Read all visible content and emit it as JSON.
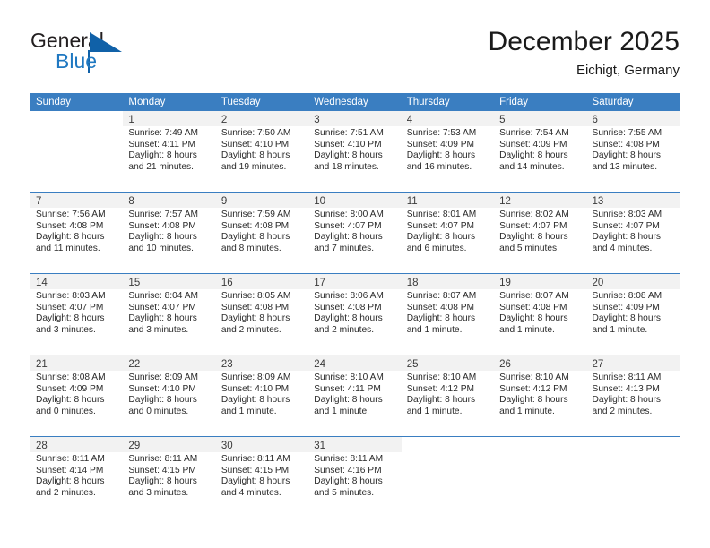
{
  "brand": {
    "name_primary": "General",
    "name_secondary": "Blue",
    "triangle_color": "#1061a8",
    "secondary_color": "#1f78c1"
  },
  "header": {
    "month_title": "December 2025",
    "location": "Eichigt, Germany"
  },
  "theme": {
    "header_blue": "#3a7ec1",
    "daynum_band": "#f2f2f2",
    "text": "#2a2a2a"
  },
  "calendar": {
    "weekday_headers": [
      "Sunday",
      "Monday",
      "Tuesday",
      "Wednesday",
      "Thursday",
      "Friday",
      "Saturday"
    ],
    "weeks": [
      [
        {
          "day": "",
          "lines": []
        },
        {
          "day": "1",
          "lines": [
            "Sunrise: 7:49 AM",
            "Sunset: 4:11 PM",
            "Daylight: 8 hours",
            "and 21 minutes."
          ]
        },
        {
          "day": "2",
          "lines": [
            "Sunrise: 7:50 AM",
            "Sunset: 4:10 PM",
            "Daylight: 8 hours",
            "and 19 minutes."
          ]
        },
        {
          "day": "3",
          "lines": [
            "Sunrise: 7:51 AM",
            "Sunset: 4:10 PM",
            "Daylight: 8 hours",
            "and 18 minutes."
          ]
        },
        {
          "day": "4",
          "lines": [
            "Sunrise: 7:53 AM",
            "Sunset: 4:09 PM",
            "Daylight: 8 hours",
            "and 16 minutes."
          ]
        },
        {
          "day": "5",
          "lines": [
            "Sunrise: 7:54 AM",
            "Sunset: 4:09 PM",
            "Daylight: 8 hours",
            "and 14 minutes."
          ]
        },
        {
          "day": "6",
          "lines": [
            "Sunrise: 7:55 AM",
            "Sunset: 4:08 PM",
            "Daylight: 8 hours",
            "and 13 minutes."
          ]
        }
      ],
      [
        {
          "day": "7",
          "lines": [
            "Sunrise: 7:56 AM",
            "Sunset: 4:08 PM",
            "Daylight: 8 hours",
            "and 11 minutes."
          ]
        },
        {
          "day": "8",
          "lines": [
            "Sunrise: 7:57 AM",
            "Sunset: 4:08 PM",
            "Daylight: 8 hours",
            "and 10 minutes."
          ]
        },
        {
          "day": "9",
          "lines": [
            "Sunrise: 7:59 AM",
            "Sunset: 4:08 PM",
            "Daylight: 8 hours",
            "and 8 minutes."
          ]
        },
        {
          "day": "10",
          "lines": [
            "Sunrise: 8:00 AM",
            "Sunset: 4:07 PM",
            "Daylight: 8 hours",
            "and 7 minutes."
          ]
        },
        {
          "day": "11",
          "lines": [
            "Sunrise: 8:01 AM",
            "Sunset: 4:07 PM",
            "Daylight: 8 hours",
            "and 6 minutes."
          ]
        },
        {
          "day": "12",
          "lines": [
            "Sunrise: 8:02 AM",
            "Sunset: 4:07 PM",
            "Daylight: 8 hours",
            "and 5 minutes."
          ]
        },
        {
          "day": "13",
          "lines": [
            "Sunrise: 8:03 AM",
            "Sunset: 4:07 PM",
            "Daylight: 8 hours",
            "and 4 minutes."
          ]
        }
      ],
      [
        {
          "day": "14",
          "lines": [
            "Sunrise: 8:03 AM",
            "Sunset: 4:07 PM",
            "Daylight: 8 hours",
            "and 3 minutes."
          ]
        },
        {
          "day": "15",
          "lines": [
            "Sunrise: 8:04 AM",
            "Sunset: 4:07 PM",
            "Daylight: 8 hours",
            "and 3 minutes."
          ]
        },
        {
          "day": "16",
          "lines": [
            "Sunrise: 8:05 AM",
            "Sunset: 4:08 PM",
            "Daylight: 8 hours",
            "and 2 minutes."
          ]
        },
        {
          "day": "17",
          "lines": [
            "Sunrise: 8:06 AM",
            "Sunset: 4:08 PM",
            "Daylight: 8 hours",
            "and 2 minutes."
          ]
        },
        {
          "day": "18",
          "lines": [
            "Sunrise: 8:07 AM",
            "Sunset: 4:08 PM",
            "Daylight: 8 hours",
            "and 1 minute."
          ]
        },
        {
          "day": "19",
          "lines": [
            "Sunrise: 8:07 AM",
            "Sunset: 4:08 PM",
            "Daylight: 8 hours",
            "and 1 minute."
          ]
        },
        {
          "day": "20",
          "lines": [
            "Sunrise: 8:08 AM",
            "Sunset: 4:09 PM",
            "Daylight: 8 hours",
            "and 1 minute."
          ]
        }
      ],
      [
        {
          "day": "21",
          "lines": [
            "Sunrise: 8:08 AM",
            "Sunset: 4:09 PM",
            "Daylight: 8 hours",
            "and 0 minutes."
          ]
        },
        {
          "day": "22",
          "lines": [
            "Sunrise: 8:09 AM",
            "Sunset: 4:10 PM",
            "Daylight: 8 hours",
            "and 0 minutes."
          ]
        },
        {
          "day": "23",
          "lines": [
            "Sunrise: 8:09 AM",
            "Sunset: 4:10 PM",
            "Daylight: 8 hours",
            "and 1 minute."
          ]
        },
        {
          "day": "24",
          "lines": [
            "Sunrise: 8:10 AM",
            "Sunset: 4:11 PM",
            "Daylight: 8 hours",
            "and 1 minute."
          ]
        },
        {
          "day": "25",
          "lines": [
            "Sunrise: 8:10 AM",
            "Sunset: 4:12 PM",
            "Daylight: 8 hours",
            "and 1 minute."
          ]
        },
        {
          "day": "26",
          "lines": [
            "Sunrise: 8:10 AM",
            "Sunset: 4:12 PM",
            "Daylight: 8 hours",
            "and 1 minute."
          ]
        },
        {
          "day": "27",
          "lines": [
            "Sunrise: 8:11 AM",
            "Sunset: 4:13 PM",
            "Daylight: 8 hours",
            "and 2 minutes."
          ]
        }
      ],
      [
        {
          "day": "28",
          "lines": [
            "Sunrise: 8:11 AM",
            "Sunset: 4:14 PM",
            "Daylight: 8 hours",
            "and 2 minutes."
          ]
        },
        {
          "day": "29",
          "lines": [
            "Sunrise: 8:11 AM",
            "Sunset: 4:15 PM",
            "Daylight: 8 hours",
            "and 3 minutes."
          ]
        },
        {
          "day": "30",
          "lines": [
            "Sunrise: 8:11 AM",
            "Sunset: 4:15 PM",
            "Daylight: 8 hours",
            "and 4 minutes."
          ]
        },
        {
          "day": "31",
          "lines": [
            "Sunrise: 8:11 AM",
            "Sunset: 4:16 PM",
            "Daylight: 8 hours",
            "and 5 minutes."
          ]
        },
        {
          "day": "",
          "lines": []
        },
        {
          "day": "",
          "lines": []
        },
        {
          "day": "",
          "lines": []
        }
      ]
    ]
  }
}
